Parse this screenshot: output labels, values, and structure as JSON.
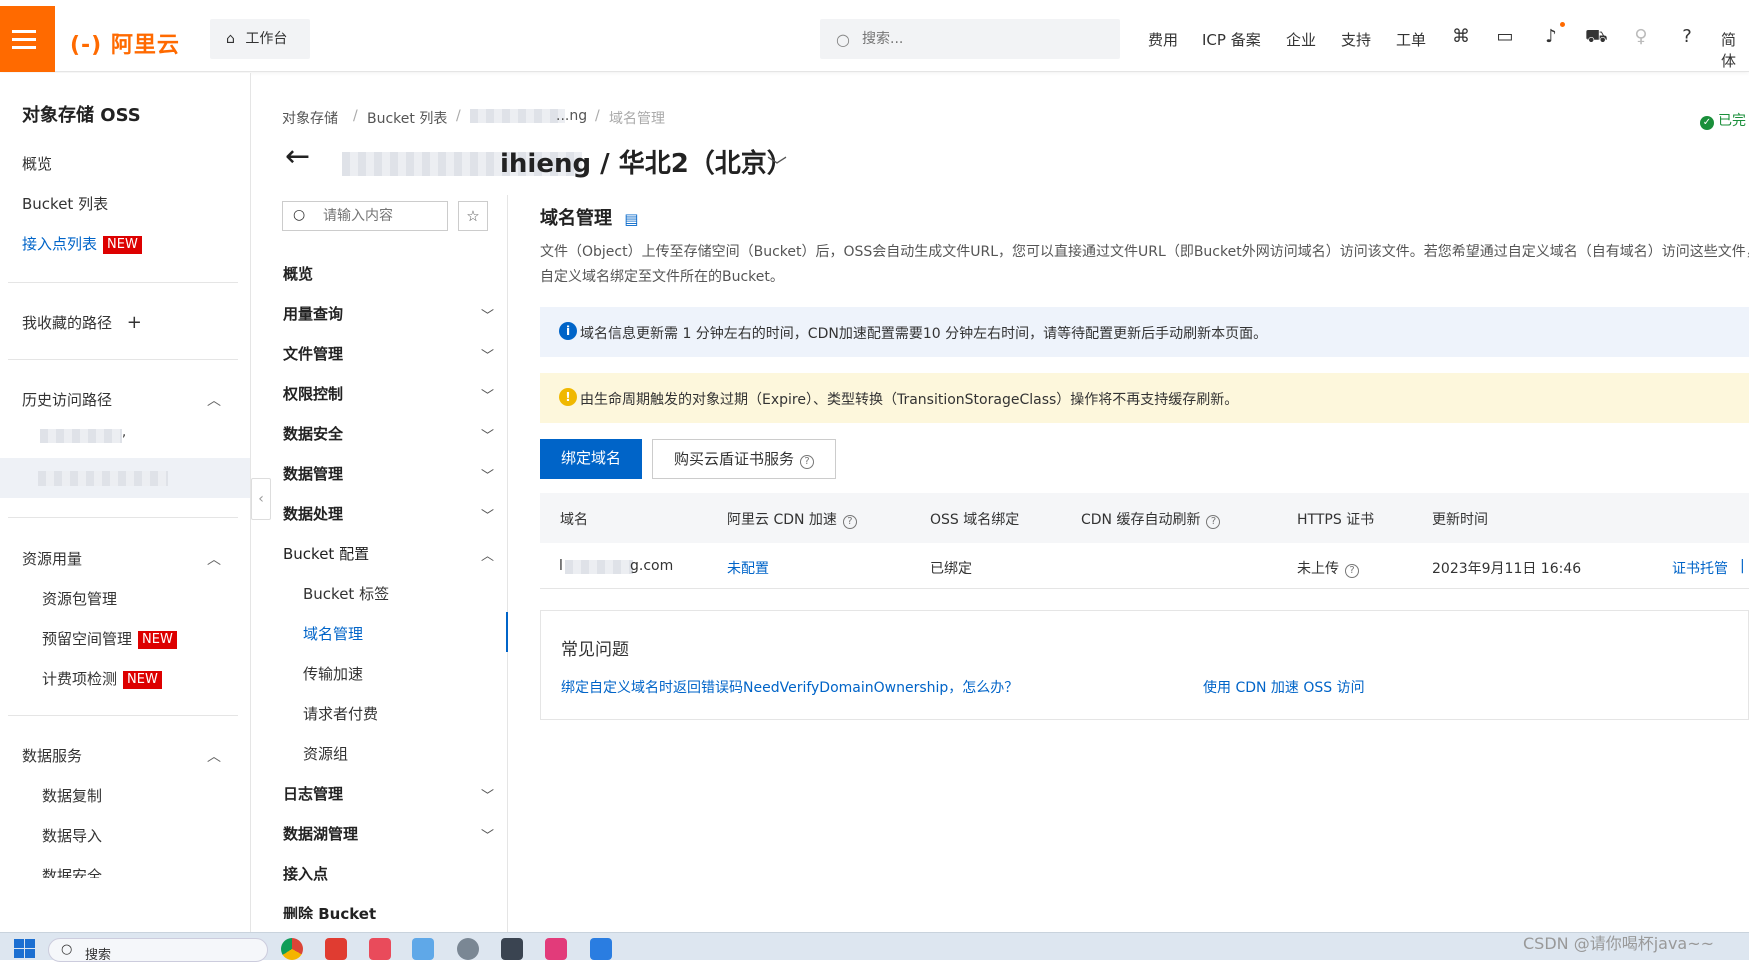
{
  "topbar": {
    "logo": "(-) 阿里云",
    "workbench": "工作台",
    "search_placeholder": "搜索...",
    "nav": [
      "费用",
      "ICP 备案",
      "企业",
      "支持",
      "工单"
    ],
    "lang": "简体"
  },
  "sidebar": {
    "title": "对象存储 OSS",
    "top_items": [
      "概览",
      "Bucket 列表"
    ],
    "access_points": "接入点列表",
    "new_badge": "NEW",
    "favorites": "我收藏的路径",
    "favorites_add": "+",
    "history": "历史访问路径",
    "history_partial": ",",
    "resource_usage": "资源用量",
    "resource_items": [
      "资源包管理",
      "预留空间管理",
      "计费项检测"
    ],
    "data_services": "数据服务",
    "data_items": [
      "数据复制",
      "数据导入",
      "数据安全"
    ]
  },
  "breadcrumb": {
    "items": [
      "对象存储",
      "Bucket 列表",
      "...ng",
      "域名管理"
    ],
    "sep": "/"
  },
  "title": {
    "bucket_suffix": "ihieng / 华北2（北京）",
    "status": "已完"
  },
  "midnav": {
    "search_placeholder": "请输入内容",
    "items_top": [
      "概览",
      "用量查询",
      "文件管理",
      "权限控制",
      "数据安全",
      "数据管理",
      "数据处理"
    ],
    "bucket_config": "Bucket 配置",
    "sub_items": [
      "Bucket 标签",
      "域名管理",
      "传输加速",
      "请求者付费",
      "资源组"
    ],
    "items_bottom": [
      "日志管理",
      "数据湖管理",
      "接入点",
      "删除 Bucket"
    ]
  },
  "main": {
    "section_title": "域名管理",
    "desc_line1": "文件（Object）上传至存储空间（Bucket）后，OSS会自动生成文件URL，您可以直接通过文件URL（即Bucket外网访问域名）访问该文件。若您希望通过自定义域名（自有域名）访问这些文件，需将",
    "desc_line2": "自定义域名绑定至文件所在的Bucket。",
    "info_text": "域名信息更新需 1 分钟左右的时间，CDN加速配置需要10 分钟左右时间，请等待配置更新后手动刷新本页面。",
    "warn_text": "由生命周期触发的对象过期（Expire）、类型转换（TransitionStorageClass）操作将不再支持缓存刷新。",
    "bind_button": "绑定域名",
    "buy_button": "购买云盾证书服务",
    "table": {
      "headers": [
        "域名",
        "阿里云 CDN 加速",
        "OSS 域名绑定",
        "CDN 缓存自动刷新",
        "HTTPS 证书",
        "更新时间"
      ],
      "row": {
        "domain_prefix": "l",
        "domain_suffix": "g.com",
        "cdn": "未配置",
        "oss_bind": "已绑定",
        "https": "未上传",
        "updated": "2023年9月11日 16:46",
        "action": "证书托管",
        "action_sep": "|"
      }
    },
    "faq": {
      "title": "常见问题",
      "links": [
        "绑定自定义域名时返回错误码NeedVerifyDomainOwnership，怎么办？",
        "使用 CDN 加速 OSS 访问"
      ]
    }
  },
  "taskbar": {
    "search_label": "搜索"
  },
  "watermark": "CSDN @请你喝杯java~~",
  "colors": {
    "brand": "#ff6a00",
    "primary": "#0064c8",
    "new_badge": "#dd0000"
  }
}
